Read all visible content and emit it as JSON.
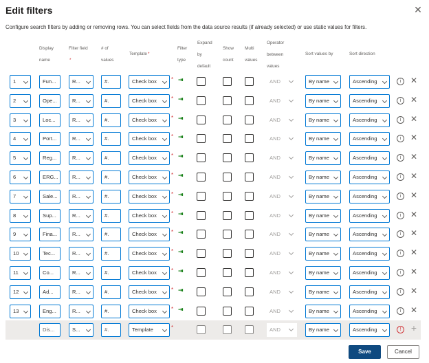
{
  "dialog": {
    "title": "Edit filters",
    "close_icon": "close-icon",
    "description": "Configure search filters by adding or removing rows. You can select fields from the data source results (if already selected) or use static values for filters."
  },
  "headers": {
    "display_name": [
      "Display",
      "name"
    ],
    "filter_field": "Filter field",
    "num_values": [
      "# of",
      "values"
    ],
    "template": "Template",
    "filter_type": [
      "Filter",
      "type"
    ],
    "expand_default": [
      "Expand",
      "by",
      "default"
    ],
    "show_count": [
      "Show",
      "count"
    ],
    "multi_values": [
      "Multi",
      "values"
    ],
    "operator": [
      "Operator",
      "between",
      "values"
    ],
    "sort_by": "Sort values by",
    "sort_direction": "Sort direction",
    "required_mark": "*"
  },
  "rows": [
    {
      "order": "1",
      "display_name": "Fun...",
      "filter_field": "R...",
      "num_values": "#.",
      "template": "Check box",
      "operator": "AND",
      "sort_by": "By name",
      "sort_dir": "Ascending"
    },
    {
      "order": "2",
      "display_name": "Ope...",
      "filter_field": "R...",
      "num_values": "#.",
      "template": "Check box",
      "operator": "AND",
      "sort_by": "By name",
      "sort_dir": "Ascending"
    },
    {
      "order": "3",
      "display_name": "Loc...",
      "filter_field": "R...",
      "num_values": "#.",
      "template": "Check box",
      "operator": "AND",
      "sort_by": "By name",
      "sort_dir": "Ascending"
    },
    {
      "order": "4",
      "display_name": "Port...",
      "filter_field": "R...",
      "num_values": "#.",
      "template": "Check box",
      "operator": "AND",
      "sort_by": "By name",
      "sort_dir": "Ascending"
    },
    {
      "order": "5",
      "display_name": "Reg...",
      "filter_field": "R...",
      "num_values": "#.",
      "template": "Check box",
      "operator": "AND",
      "sort_by": "By name",
      "sort_dir": "Ascending"
    },
    {
      "order": "6",
      "display_name": "ERG...",
      "filter_field": "R...",
      "num_values": "#.",
      "template": "Check box",
      "operator": "AND",
      "sort_by": "By name",
      "sort_dir": "Ascending"
    },
    {
      "order": "7",
      "display_name": "Sale...",
      "filter_field": "R...",
      "num_values": "#.",
      "template": "Check box",
      "operator": "AND",
      "sort_by": "By name",
      "sort_dir": "Ascending"
    },
    {
      "order": "8",
      "display_name": "Sup...",
      "filter_field": "R...",
      "num_values": "#.",
      "template": "Check box",
      "operator": "AND",
      "sort_by": "By name",
      "sort_dir": "Ascending"
    },
    {
      "order": "9",
      "display_name": "Fina...",
      "filter_field": "R...",
      "num_values": "#.",
      "template": "Check box",
      "operator": "AND",
      "sort_by": "By name",
      "sort_dir": "Ascending"
    },
    {
      "order": "10",
      "display_name": "Tec...",
      "filter_field": "R...",
      "num_values": "#.",
      "template": "Check box",
      "operator": "AND",
      "sort_by": "By name",
      "sort_dir": "Ascending"
    },
    {
      "order": "11",
      "display_name": "Co...",
      "filter_field": "R...",
      "num_values": "#.",
      "template": "Check box",
      "operator": "AND",
      "sort_by": "By name",
      "sort_dir": "Ascending"
    },
    {
      "order": "12",
      "display_name": "Ad...",
      "filter_field": "R...",
      "num_values": "#.",
      "template": "Check box",
      "operator": "AND",
      "sort_by": "By name",
      "sort_dir": "Ascending"
    },
    {
      "order": "13",
      "display_name": "Eng...",
      "filter_field": "R...",
      "num_values": "#.",
      "template": "Check box",
      "operator": "AND",
      "sort_by": "By name",
      "sort_dir": "Ascending"
    }
  ],
  "new_row": {
    "display_name_placeholder": "Dis...",
    "filter_field_placeholder": "S...",
    "num_values_placeholder": "#.",
    "template_placeholder": "Template",
    "operator": "AND",
    "sort_by": "By name",
    "sort_dir": "Ascending",
    "add_icon": "plus-icon",
    "error_icon": "error-info-icon"
  },
  "icons": {
    "filter_type": "filter-type-arrow-icon",
    "info": "info-icon",
    "delete": "close-icon"
  },
  "footer": {
    "save_label": "Save",
    "cancel_label": "Cancel"
  }
}
